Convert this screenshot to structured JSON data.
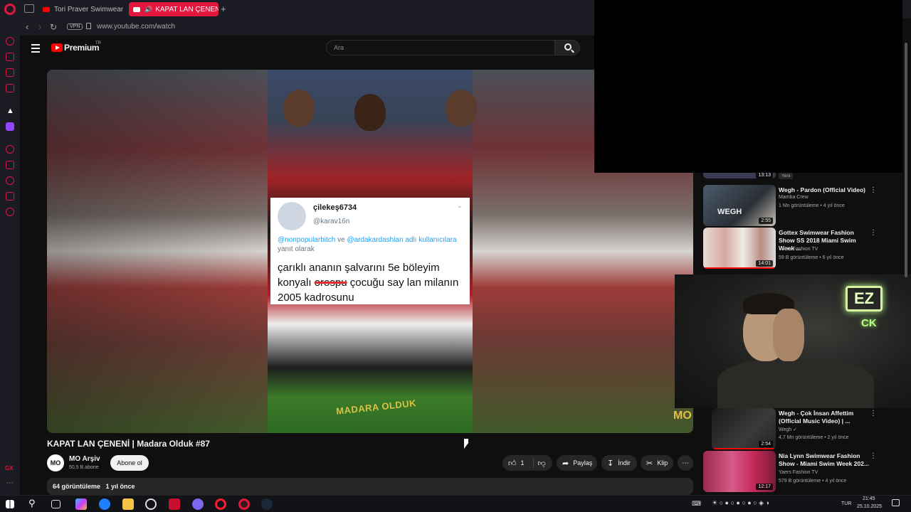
{
  "browser": {
    "tabs": [
      {
        "label": "Tori Praver Swimwear Fa"
      },
      {
        "label": "KAPAT LAN ÇENENİ |"
      }
    ],
    "new_tab": "+",
    "vpn_label": "VPN",
    "url": "www.youtube.com/watch"
  },
  "youtube": {
    "logo_text": "Premium",
    "logo_region": "TR",
    "search_placeholder": "Ara"
  },
  "video": {
    "title": "KAPAT LAN ÇENENİ | Madara Olduk #87",
    "channel": "MO Arşiv",
    "channel_initials": "MO",
    "subscribers": "50,5 B abone",
    "subscribe_label": "Abone ol",
    "likes": "1",
    "share_label": "Paylaş",
    "download_label": "İndir",
    "clip_label": "Klip",
    "views": "64 görüntüleme",
    "age": "1 yıl önce",
    "watermark": "MO",
    "frame_logo": "MADARA OLDUK"
  },
  "tweet": {
    "name": "çilekeş6734",
    "handle": "@karav16n",
    "mention1": "@nonpopularbitch",
    "reply_mid": " ve ",
    "mention2": "@ardakardashian adlı kullanıcılara",
    "reply_suffix": " yanıt olarak",
    "text_a": "çarıklı ananın şalvarını 5e böleyim konyalı ",
    "text_strike": "orospu",
    "text_b": " çocuğu say lan milanın 2005 kadrosunu"
  },
  "recommendations": {
    "partial_top_duration": "13:13",
    "new_badge": "Yeni",
    "items": [
      {
        "title": "Wegh - Pardon (Official Video)",
        "channel": "Mamba Crew",
        "meta": "1 Mn görüntüleme • 4 yıl önce",
        "duration": "2:55",
        "thumb_text": "WEGH"
      },
      {
        "title": "Gottex Swimwear Fashion Show SS 2018 Miami Swim Week ...",
        "channel": "Yaers Fashion TV",
        "meta": "59 B görüntüleme • 6 yıl önce",
        "duration": "14:01"
      },
      {
        "title": "Wegh - Çok İnsan Affettim (Official Music Video) | ...",
        "channel": "Wegh ✓",
        "meta": "4,7 Mn görüntüleme • 2 yıl önce",
        "duration": "2:54"
      },
      {
        "title": "Nia Lynn Swimwear Fashion Show - Miami Swim Week 202...",
        "channel": "Yaers Fashion TV",
        "meta": "579 B görüntüleme • 4 yıl önce",
        "duration": "12:17"
      }
    ]
  },
  "webcam": {
    "neon_text": "EZ",
    "neon_text2": "CK"
  },
  "taskbar": {
    "language": "TUR",
    "time": "21:45",
    "date": "25.10.2025"
  }
}
